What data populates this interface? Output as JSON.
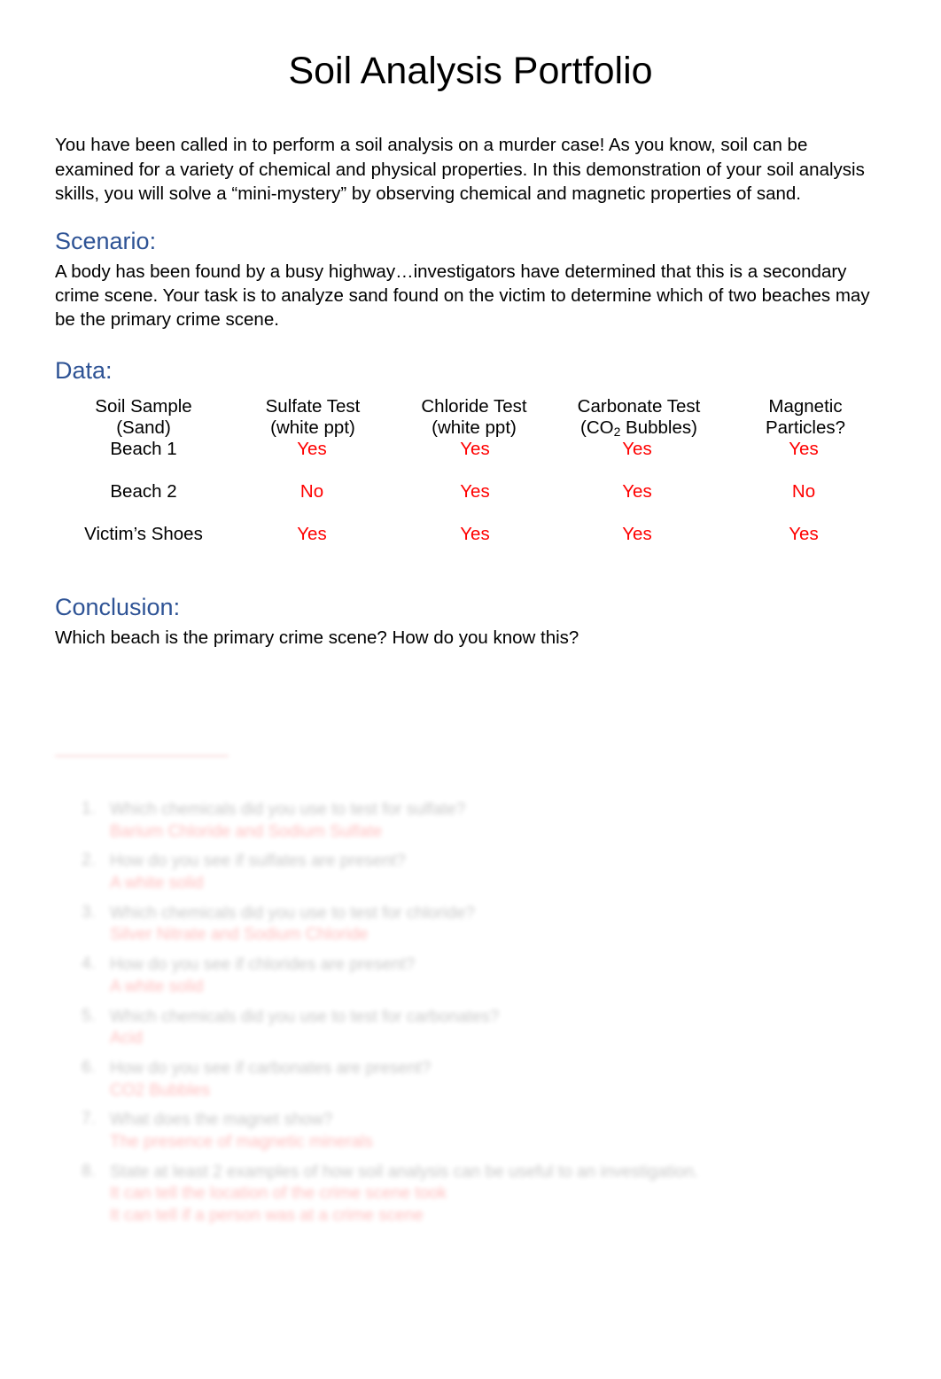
{
  "document": {
    "title": "Soil Analysis Portfolio",
    "intro": "You have been called in to perform a soil analysis on a murder case! As you know, soil can be examined for a variety of chemical and physical properties. In this demonstration of your soil analysis skills, you will solve a “mini-mystery” by observing chemical and magnetic properties of sand."
  },
  "scenario": {
    "heading": "Scenario:",
    "text": "A body has been found by a busy highway…investigators have determined that this is a secondary crime scene. Your task is to analyze sand found on the victim to determine which of two beaches may be the primary crime scene."
  },
  "data": {
    "heading": "Data:",
    "columns": [
      {
        "line1": "Soil Sample",
        "line2": "(Sand)"
      },
      {
        "line1": "Sulfate Test",
        "line2": "(white ppt)"
      },
      {
        "line1": "Chloride Test",
        "line2": "(white ppt)"
      },
      {
        "line1": "Carbonate Test",
        "line2": "(CO",
        "sub": "2",
        "line2b": " Bubbles)"
      },
      {
        "line1": "Magnetic",
        "line2": "Particles?"
      }
    ],
    "rows": [
      {
        "sample": "Beach 1",
        "sulfate": "Yes",
        "chloride": "Yes",
        "carbonate": "Yes",
        "magnetic": "Yes"
      },
      {
        "sample": "Beach 2",
        "sulfate": "No",
        "chloride": "Yes",
        "carbonate": "Yes",
        "magnetic": "No"
      },
      {
        "sample": "Victim’s Shoes",
        "sulfate": "Yes",
        "chloride": "Yes",
        "carbonate": "Yes",
        "magnetic": "Yes"
      }
    ]
  },
  "conclusion": {
    "heading": "Conclusion:",
    "prompt": "Which beach is the primary crime scene? How do you know this?"
  },
  "appendix": {
    "items": [
      {
        "number": "1.",
        "question": "Which chemicals did you use to test for sulfate?",
        "answers": [
          "Barium Chloride and Sodium Sulfate"
        ]
      },
      {
        "number": "2.",
        "question": "How do you see if sulfates are present?",
        "answers": [
          "A white solid"
        ]
      },
      {
        "number": "3.",
        "question": "Which chemicals did you use to test for chloride?",
        "answers": [
          "Silver Nitrate and Sodium Chloride"
        ]
      },
      {
        "number": "4.",
        "question": "How do you see if chlorides are present?",
        "answers": [
          "A white solid"
        ]
      },
      {
        "number": "5.",
        "question": "Which chemicals did you use to test for carbonates?",
        "answers": [
          "Acid"
        ]
      },
      {
        "number": "6.",
        "question": "How do you see if carbonates are present?",
        "answers": [
          "CO2 Bubbles"
        ]
      },
      {
        "number": "7.",
        "question": "What does the magnet show?",
        "answers": [
          "The presence of magnetic minerals"
        ]
      },
      {
        "number": "8.",
        "question": "State at least 2 examples of how soil analysis can be useful to an investigation.",
        "answers": [
          "It can tell the location of the crime scene took",
          "It can tell if a person was at a crime scene"
        ]
      }
    ]
  },
  "colors": {
    "heading_blue": "#2E5395",
    "result_red": "#FF0000",
    "text_black": "#000000",
    "page_background": "#FFFFFF"
  }
}
